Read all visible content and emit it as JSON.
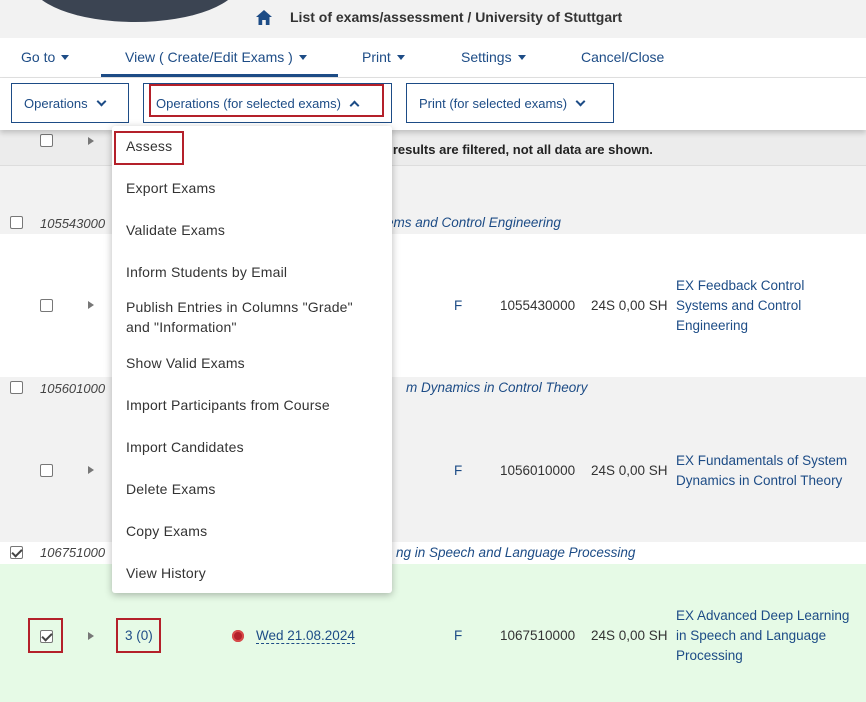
{
  "header": {
    "title": "List of exams/assessment",
    "institution": "/ University of Stuttgart"
  },
  "nav": {
    "goto": "Go to",
    "view": "View ( Create/Edit Exams )",
    "print": "Print",
    "settings": "Settings",
    "cancel": "Cancel/Close"
  },
  "toolbar": {
    "operations": "Operations",
    "operations_selected": "Operations (for selected exams)",
    "print_selected": "Print (for selected exams)"
  },
  "table": {
    "filter_notice": "e results are filtered, not all data are shown.",
    "groups": [
      {
        "id": "105543000",
        "title": "ems and Control Engineering",
        "type": "F",
        "number": "1055430000",
        "term": "24S 0,00 SH",
        "name_lines": [
          "EX Feedback Control",
          "Systems and Control",
          "Engineering"
        ]
      },
      {
        "id": "105601000",
        "title": "m Dynamics in Control Theory",
        "type": "F",
        "number": "1056010000",
        "term": "24S 0,00 SH",
        "name_lines": [
          "EX Fundamentals of System",
          "Dynamics in Control Theory"
        ]
      },
      {
        "id": "106751000",
        "title": "ng in Speech and Language Processing",
        "type": "F",
        "number": "1067510000",
        "term": "24S 0,00 SH",
        "count": "3 (0)",
        "date": "Wed 21.08.2024",
        "name_lines": [
          "EX Advanced Deep Learning",
          "in Speech and Language",
          "Processing"
        ]
      }
    ]
  },
  "dropdown": {
    "items": [
      "Assess",
      "Export Exams",
      "Validate Exams",
      "Inform Students by Email",
      "Publish Entries in Columns \"Grade\"",
      "and \"Information\"",
      "Show Valid Exams",
      "Import Participants from Course",
      "Import Candidates",
      "Delete Exams",
      "Copy Exams",
      "View History"
    ]
  },
  "colors": {
    "accent": "#1d4c86",
    "highlight": "#b4202a",
    "selected_row": "#e6fae6",
    "grey_row": "#f2f2f2"
  }
}
